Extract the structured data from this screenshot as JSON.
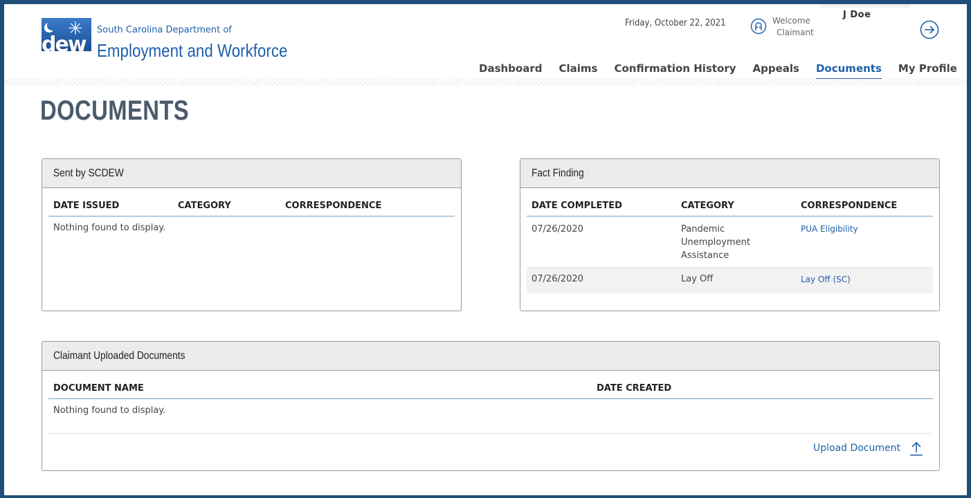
{
  "header": {
    "dept_line1": "South Carolina Department of",
    "dept_line2": "Employment and Workforce",
    "logo_text": "dew",
    "date": "Friday, October 22, 2021",
    "welcome": "Welcome",
    "role": "Claimant",
    "user_name": "J Doe",
    "nav": [
      {
        "label": "Dashboard",
        "active": false
      },
      {
        "label": "Claims",
        "active": false
      },
      {
        "label": "Confirmation History",
        "active": false
      },
      {
        "label": "Appeals",
        "active": false
      },
      {
        "label": "Documents",
        "active": true
      },
      {
        "label": "My Profile",
        "active": false
      }
    ],
    "icons": {
      "user": "user-circle-icon",
      "logout": "logout-arrow-icon"
    }
  },
  "page_title": "DOCUMENTS",
  "sent": {
    "title": "Sent by SCDEW",
    "columns": [
      "DATE ISSUED",
      "CATEGORY",
      "CORRESPONDENCE"
    ],
    "empty": "Nothing found to display."
  },
  "fact": {
    "title": "Fact Finding",
    "columns": [
      "DATE COMPLETED",
      "CATEGORY",
      "CORRESPONDENCE"
    ],
    "rows": [
      {
        "date": "07/26/2020",
        "category": "Pandemic Unemployment Assistance",
        "link": "PUA Eligibility"
      },
      {
        "date": "07/26/2020",
        "category": "Lay Off",
        "link": "Lay Off (SC)"
      }
    ]
  },
  "uploaded": {
    "title": "Claimant Uploaded Documents",
    "columns": [
      "DOCUMENT NAME",
      "DATE CREATED"
    ],
    "empty": "Nothing found to display.",
    "upload_label": "Upload Document"
  },
  "colors": {
    "brand": "#1f5faa",
    "frame": "#1f4e79",
    "panel_head": "#ececec"
  }
}
